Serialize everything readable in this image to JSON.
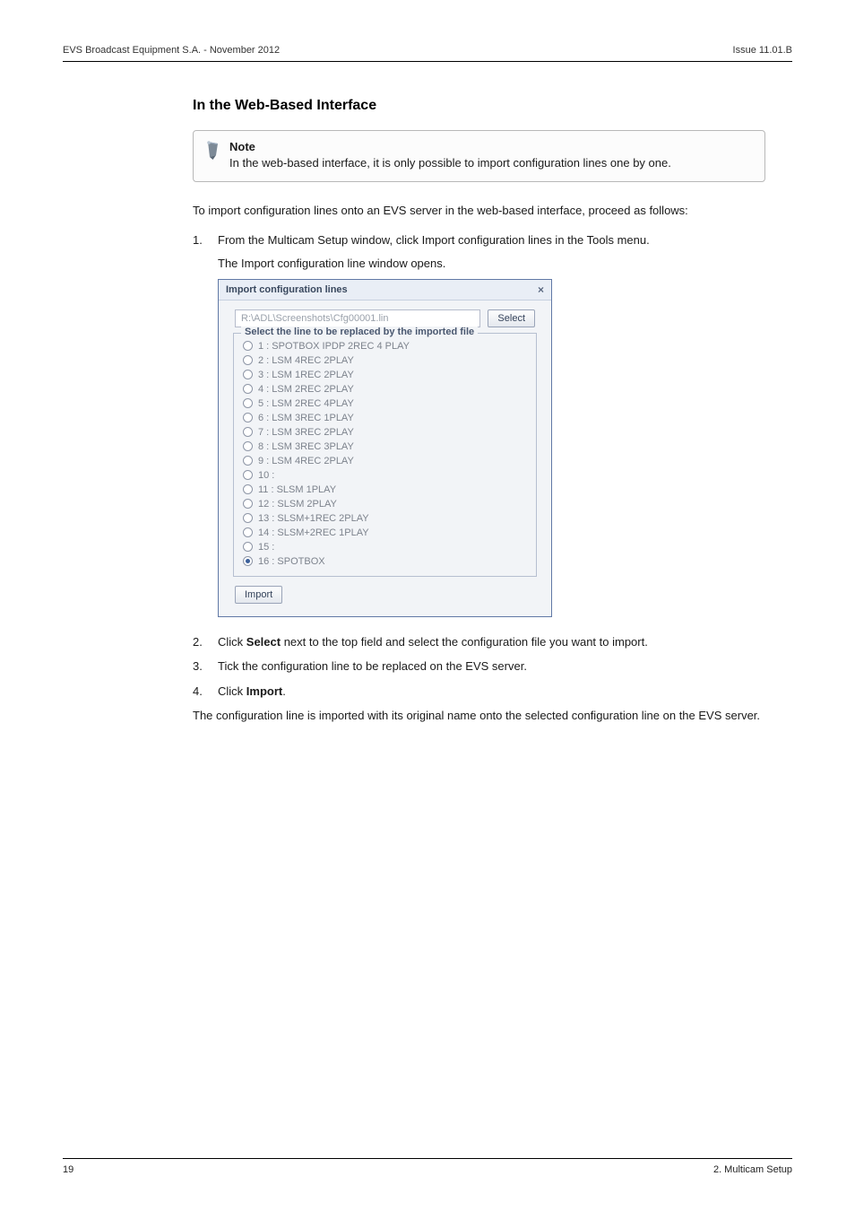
{
  "header": {
    "left": "EVS Broadcast Equipment S.A. - November 2012",
    "right": "Issue 11.01.B"
  },
  "section_title": "In the Web-Based Interface",
  "note": {
    "title": "Note",
    "text": "In the web-based interface, it is only possible to import configuration lines one by one."
  },
  "intro": "To import configuration lines onto an EVS server in the web-based interface, proceed as follows:",
  "steps": {
    "s1_num": "1.",
    "s1_text": "From the Multicam Setup window, click Import configuration lines in the Tools menu.",
    "s1_sub": "The Import configuration line window opens.",
    "s2_num": "2.",
    "s2_pre": "Click ",
    "s2_bold": "Select",
    "s2_post": " next to the top field and select the configuration file you want to import.",
    "s3_num": "3.",
    "s3_text": "Tick the configuration line to be replaced on the EVS server.",
    "s4_num": "4.",
    "s4_pre": "Click ",
    "s4_bold": "Import",
    "s4_post": "."
  },
  "outro": "The configuration line is imported with its original name onto the selected configuration line on the EVS server.",
  "dialog": {
    "title": "Import configuration lines",
    "close": "×",
    "path": "R:\\ADL\\Screenshots\\Cfg00001.lin",
    "select_btn": "Select",
    "legend": "Select the line to be replaced by the imported file",
    "options": [
      {
        "label": "1 : SPOTBOX IPDP 2REC 4 PLAY",
        "checked": false
      },
      {
        "label": "2 : LSM 4REC 2PLAY",
        "checked": false
      },
      {
        "label": "3 : LSM 1REC 2PLAY",
        "checked": false
      },
      {
        "label": "4 : LSM 2REC 2PLAY",
        "checked": false
      },
      {
        "label": "5 : LSM 2REC 4PLAY",
        "checked": false
      },
      {
        "label": "6 : LSM 3REC 1PLAY",
        "checked": false
      },
      {
        "label": "7 : LSM 3REC 2PLAY",
        "checked": false
      },
      {
        "label": "8 : LSM 3REC 3PLAY",
        "checked": false
      },
      {
        "label": "9 : LSM 4REC 2PLAY",
        "checked": false
      },
      {
        "label": "10 :",
        "checked": false
      },
      {
        "label": "11 : SLSM 1PLAY",
        "checked": false
      },
      {
        "label": "12 : SLSM 2PLAY",
        "checked": false
      },
      {
        "label": "13 : SLSM+1REC 2PLAY",
        "checked": false
      },
      {
        "label": "14 : SLSM+2REC 1PLAY",
        "checked": false
      },
      {
        "label": "15 :",
        "checked": false
      },
      {
        "label": "16 : SPOTBOX",
        "checked": true
      }
    ],
    "import_btn": "Import"
  },
  "footer": {
    "left": "19",
    "right": "2. Multicam Setup"
  }
}
